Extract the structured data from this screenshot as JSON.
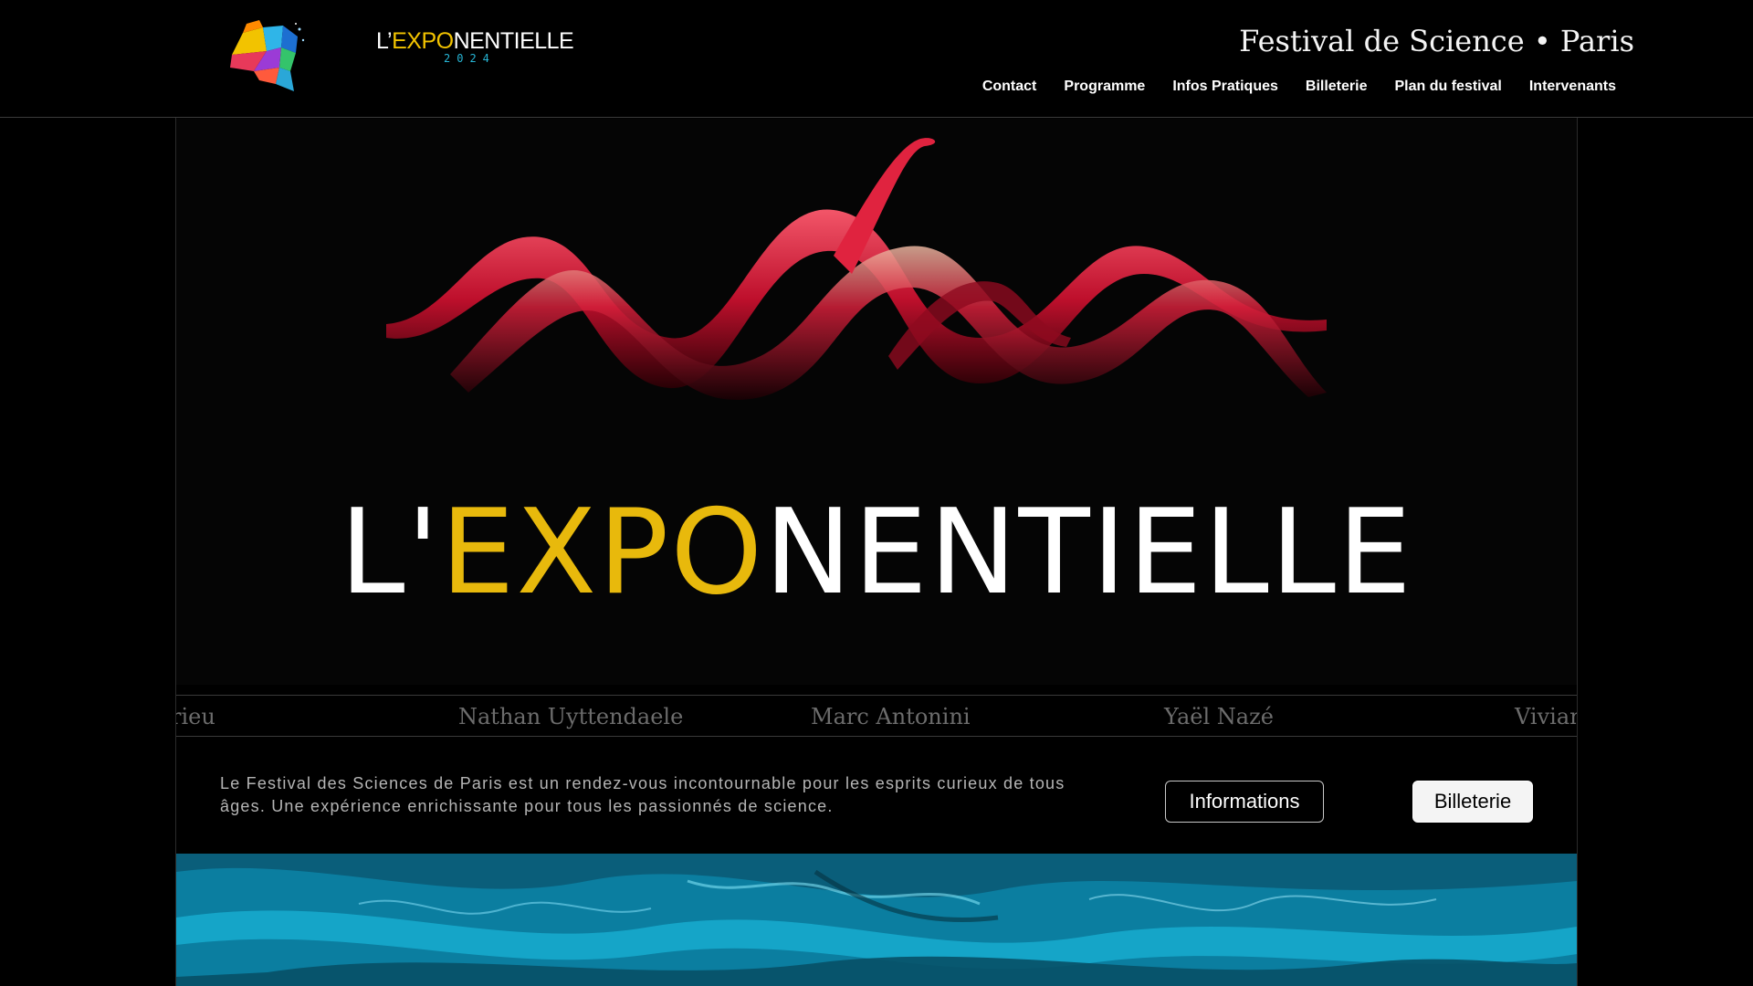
{
  "header": {
    "logo_alt": "brain-logo",
    "wordmark": {
      "prefix": "L’",
      "highlight": "EXPO",
      "suffix": "NENTIELLE",
      "year": "2024"
    },
    "tagline": "Festival de Science • Paris",
    "nav": [
      {
        "label": "Contact"
      },
      {
        "label": "Programme"
      },
      {
        "label": "Infos Pratiques"
      },
      {
        "label": "Billeterie"
      },
      {
        "label": "Plan du festival"
      },
      {
        "label": "Intervenants"
      }
    ]
  },
  "hero": {
    "title_prefix": "L'",
    "title_highlight": "EXPO",
    "title_suffix": "NENTIELLE"
  },
  "speakers_marquee": [
    "rieu",
    "Nathan Uyttendaele",
    "Marc Antonini",
    "Yaël Nazé",
    "Vivian"
  ],
  "intro": {
    "text": "Le Festival des Sciences de Paris est un rendez-vous incontournable pour les esprits curieux de tous âges. Une expérience enrichissante pour tous les passionnés de science."
  },
  "buttons": {
    "info_label": "Informations",
    "ticket_label": "Billeterie"
  },
  "colors": {
    "accent_yellow": "#e8b90c",
    "year_cyan": "#27b6d6",
    "background": "#000000"
  }
}
